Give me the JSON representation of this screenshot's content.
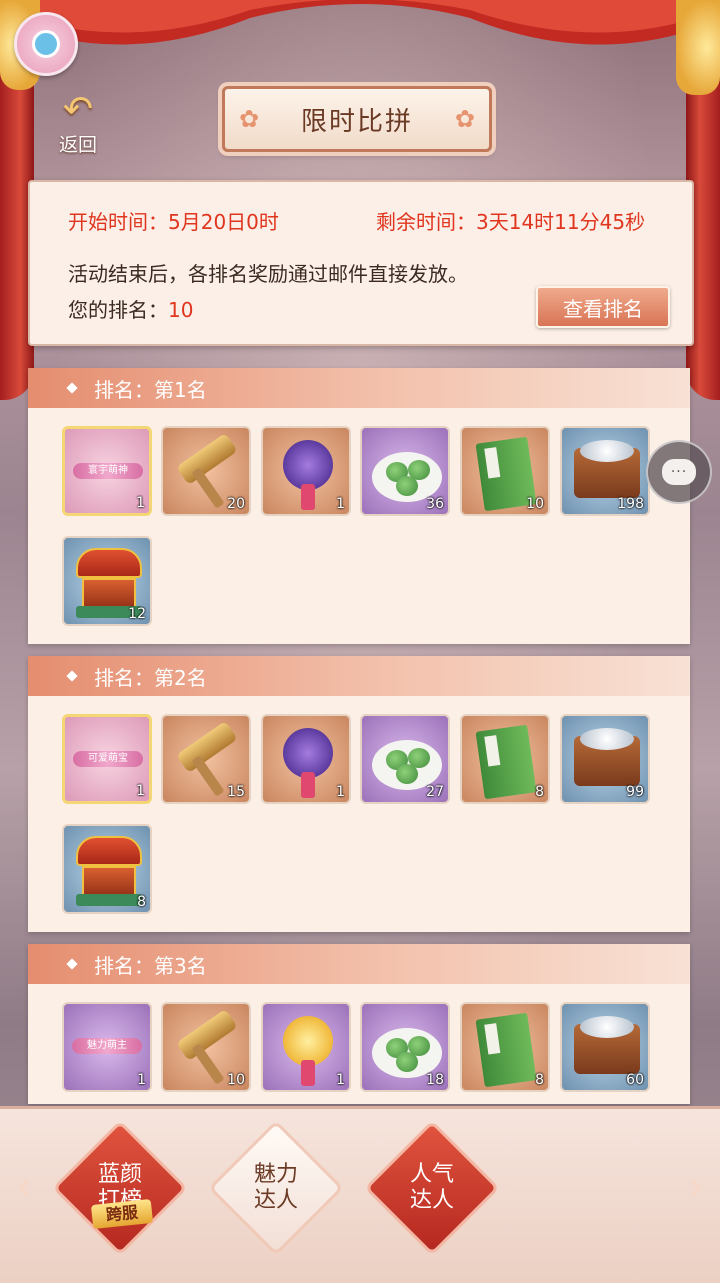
{
  "header": {
    "back_label": "返回",
    "title": "限时比拼"
  },
  "info": {
    "start_label": "开始时间：",
    "start_value": "5月20日0时",
    "remain_label": "剩余时间：",
    "remain_value": "3天14时11分45秒",
    "notice": "活动结束后，各排名奖励通过邮件直接发放。",
    "your_rank_label": "您的排名：",
    "your_rank_value": "10",
    "view_rank_button": "查看排名"
  },
  "sections": [
    {
      "title": "排名：第1名",
      "items": [
        {
          "icon": "title-card-icon",
          "text": "寰宇萌神",
          "count": "1"
        },
        {
          "icon": "hammer-icon",
          "count": "20"
        },
        {
          "icon": "purple-bouquet-icon",
          "count": "1"
        },
        {
          "icon": "green-dumpling-plate-icon",
          "count": "36"
        },
        {
          "icon": "green-book-icon",
          "count": "10"
        },
        {
          "icon": "silver-chest-icon",
          "count": "198"
        },
        {
          "icon": "treasure-chest-icon",
          "count": "12"
        }
      ]
    },
    {
      "title": "排名：第2名",
      "items": [
        {
          "icon": "title-card-icon",
          "text": "可爱萌宝",
          "count": "1"
        },
        {
          "icon": "hammer-icon",
          "count": "15"
        },
        {
          "icon": "purple-bouquet-icon",
          "count": "1"
        },
        {
          "icon": "green-dumpling-plate-icon",
          "count": "27"
        },
        {
          "icon": "green-book-icon",
          "count": "8"
        },
        {
          "icon": "silver-chest-icon",
          "count": "99"
        },
        {
          "icon": "treasure-chest-icon",
          "count": "8"
        }
      ]
    },
    {
      "title": "排名：第3名",
      "items": [
        {
          "icon": "title-card-icon",
          "text": "魅力萌主",
          "count": "1"
        },
        {
          "icon": "hammer-icon",
          "count": "10"
        },
        {
          "icon": "yellow-bouquet-icon",
          "count": "1"
        },
        {
          "icon": "green-dumpling-plate-icon",
          "count": "18"
        },
        {
          "icon": "green-book-icon",
          "count": "8"
        },
        {
          "icon": "silver-chest-icon",
          "count": "60"
        }
      ]
    }
  ],
  "bottom_tabs": [
    {
      "label_line1": "蓝颜",
      "label_line2": "打榜",
      "badge": "跨服",
      "selected": false
    },
    {
      "label_line1": "魅力",
      "label_line2": "达人",
      "selected": true
    },
    {
      "label_line1": "人气",
      "label_line2": "达人",
      "selected": false
    }
  ],
  "colors": {
    "accent_red": "#e0351e",
    "header_gradient": "#e58d6f",
    "panel_bg": "#fbefe6"
  }
}
